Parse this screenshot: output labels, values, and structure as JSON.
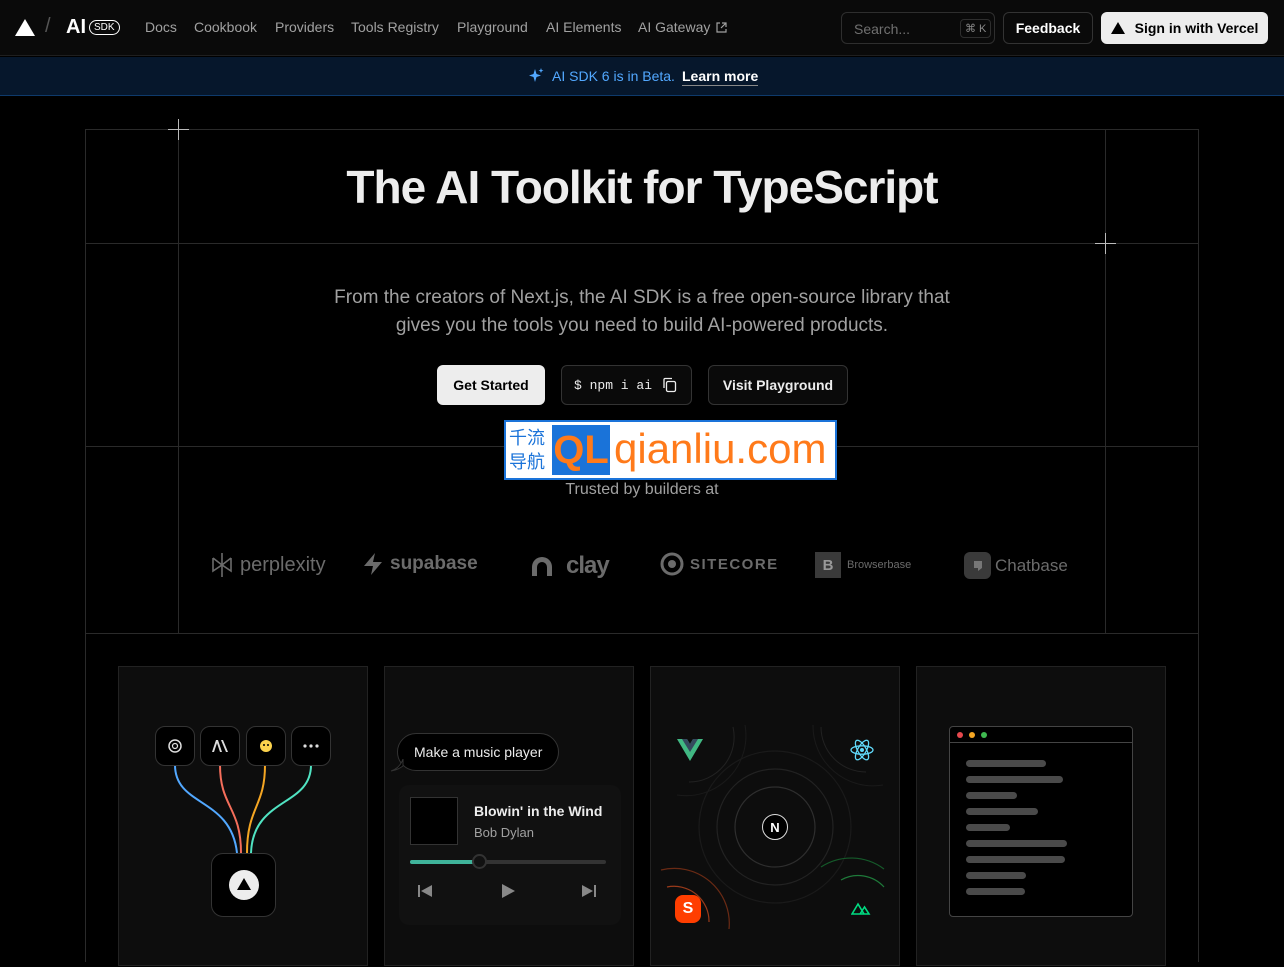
{
  "nav": {
    "brand": "AI",
    "brand_badge": "SDK",
    "slash": "/",
    "links": [
      "Docs",
      "Cookbook",
      "Providers",
      "Tools Registry",
      "Playground",
      "AI Elements",
      "AI Gateway"
    ],
    "external_icon": "external-link-icon",
    "search_placeholder": "Search...",
    "search_shortcut": "⌘ K",
    "feedback": "Feedback",
    "sign_in": "Sign in with Vercel"
  },
  "banner": {
    "text": "AI SDK 6 is in Beta.",
    "link": "Learn more",
    "icon": "sparkle-icon"
  },
  "hero": {
    "title": "The AI Toolkit for TypeScript",
    "subtitle_line1": "From the creators of Next.js, the AI SDK is a free open-source library that",
    "subtitle_line2": "gives you the tools you need to build AI-powered products.",
    "cta_primary": "Get Started",
    "install_cmd": "$ npm i ai",
    "cta_secondary": "Visit Playground"
  },
  "watermark": {
    "cn1": "千流",
    "cn2": "导航",
    "mark": "QL",
    "domain": "qianliu.com"
  },
  "trusted": {
    "label": "Trusted by builders at",
    "logos": [
      "perplexity",
      "supabase",
      "clay",
      "SITECORE",
      "Browserbase",
      "Chatbase"
    ]
  },
  "cards": {
    "music": {
      "prompt": "Make a music player",
      "song": "Blowin' in the Wind",
      "artist": "Bob Dylan",
      "progress": 0.35
    }
  },
  "colors": {
    "accent_blue": "#52a8ff",
    "background": "#000000",
    "watermark_orange": "#ff7a1a",
    "watermark_blue": "#1a73d9"
  }
}
